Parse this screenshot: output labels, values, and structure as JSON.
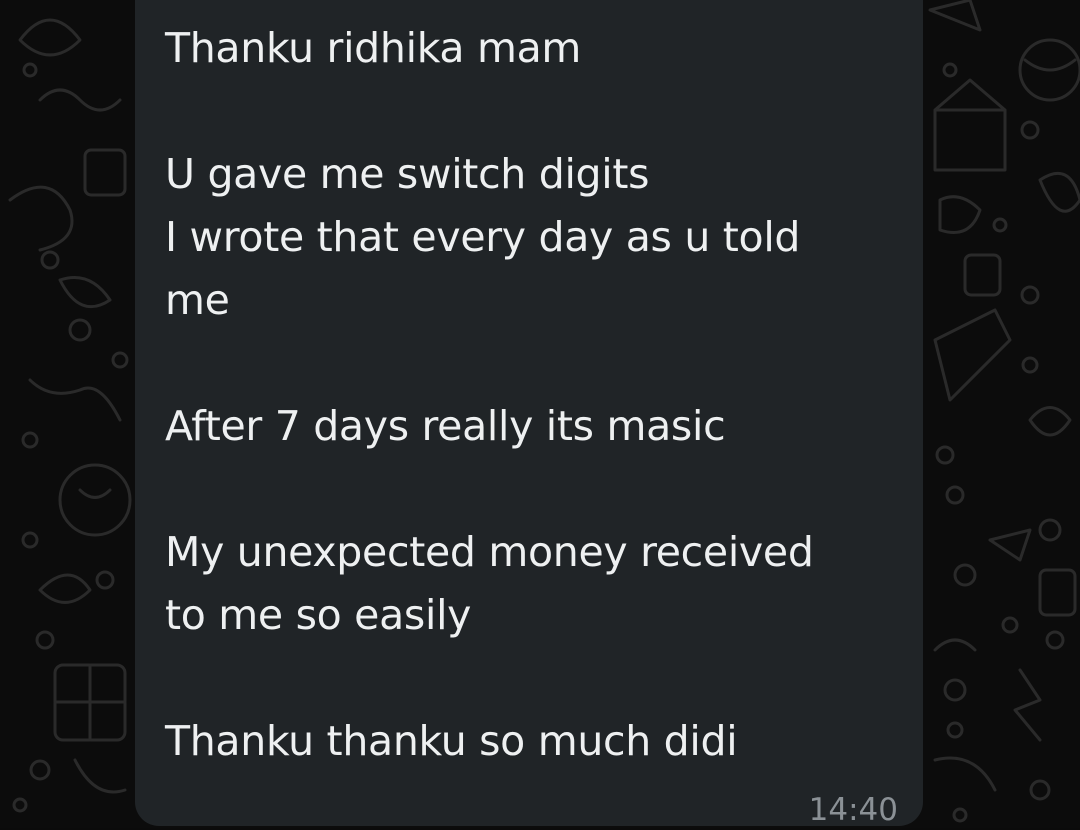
{
  "message": {
    "lines": [
      "Thanku ridhika mam",
      "U gave me switch digits",
      "I wrote that every day as u told",
      "me",
      "After 7 days really its masic",
      "My unexpected money received",
      "to me so easily",
      "Thanku thanku so much didi"
    ],
    "time": "14:40"
  },
  "theme": {
    "background": "#0c0c0c",
    "bubble": "#202427",
    "text": "#eef0f1",
    "timestamp": "#8b9196"
  }
}
